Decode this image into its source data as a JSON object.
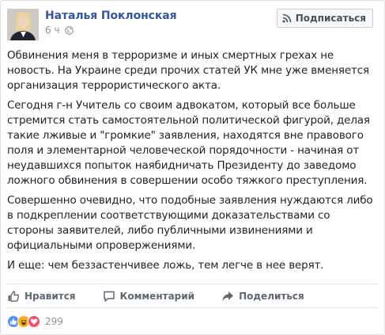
{
  "post": {
    "author": "Наталья Поклонская",
    "time": "6 ч",
    "follow_label": "Подписаться",
    "paragraphs": [
      "Обвинения меня в терроризме и иных смертных грехах не новость. На Украине среди прочих статей УК мне уже вменяется организация террористического акта.",
      "Сегодня г-н Учитель со своим адвокатом, который все больше стремится стать самостоятельной политической фигурой, делая такие лживые и \"громкие\" заявления, находятся вне правового поля и элементарной человеческой порядочности - начиная от неудавшихся попыток наябидничать Президенту до заведомо ложного обвинения в совершении особо тяжкого преступления.",
      "Совершенно очевидно, что подобные заявления нуждаются либо в подкреплении соответствующими доказательствами со стороны заявителей, либо публичными извинениями и официальными опровержениями.",
      "И еще: чем беззастенчивее ложь, тем легче в нее верят."
    ]
  },
  "actions": {
    "like_label": "Нравится",
    "comment_label": "Комментарий",
    "share_label": "Поделиться"
  },
  "reactions": {
    "icons": [
      "like-icon",
      "haha-icon",
      "love-icon"
    ],
    "count": "299"
  },
  "colors": {
    "author_link": "#365899",
    "meta_gray": "#90949c",
    "like_blue": "#5890ff",
    "haha_yellow": "#f7b125",
    "love_red": "#f25268"
  }
}
